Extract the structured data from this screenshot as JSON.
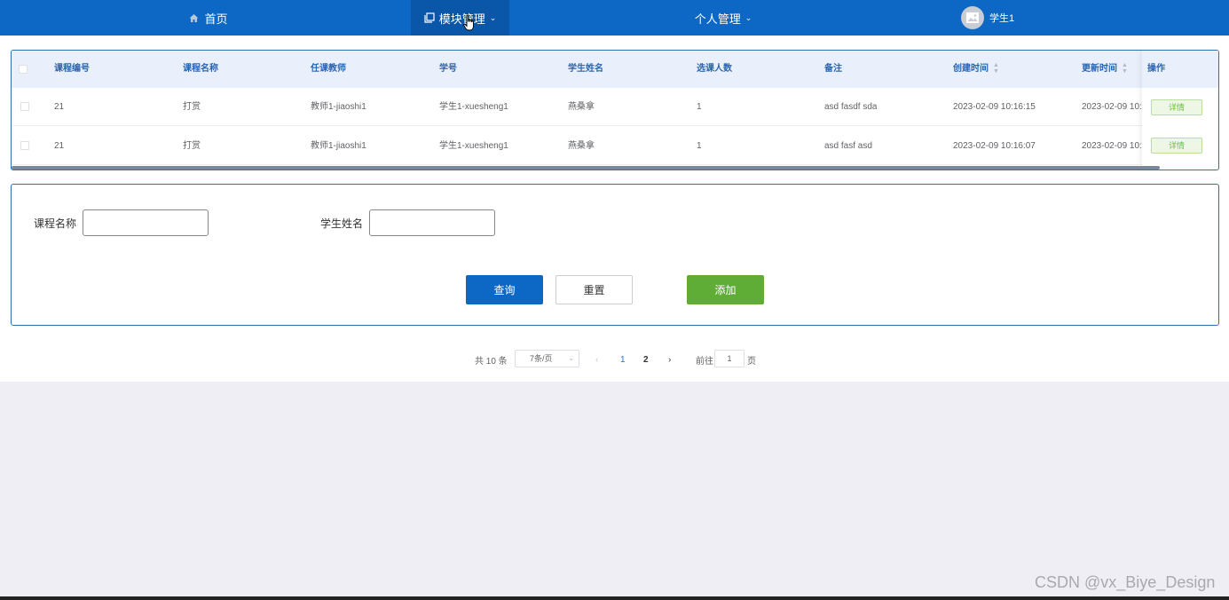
{
  "nav": {
    "home": "首页",
    "module": "模块管理",
    "personal": "个人管理",
    "user": "学生1"
  },
  "table": {
    "headers": [
      "课程编号",
      "课程名称",
      "任课教师",
      "学号",
      "学生姓名",
      "选课人数",
      "备注",
      "创建时间",
      "更新时间",
      "操作"
    ],
    "rows": [
      {
        "course_id": "21",
        "course_name": "打赏",
        "teacher": "教师1-jiaoshi1",
        "student_no": "学生1-xuesheng1",
        "student_name": "燕桑拿",
        "count": "1",
        "remark": "asd fasdf sda",
        "created": "2023-02-09 10:16:15",
        "updated": "2023-02-09 10:",
        "action": "详情"
      },
      {
        "course_id": "21",
        "course_name": "打赏",
        "teacher": "教师1-jiaoshi1",
        "student_no": "学生1-xuesheng1",
        "student_name": "燕桑拿",
        "count": "1",
        "remark": "asd fasf asd",
        "created": "2023-02-09 10:16:07",
        "updated": "2023-02-09 10:",
        "action": "详情"
      }
    ]
  },
  "search": {
    "course_name_label": "课程名称",
    "course_name_value": "",
    "student_name_label": "学生姓名",
    "student_name_value": "",
    "query_btn": "查询",
    "reset_btn": "重置",
    "add_btn": "添加"
  },
  "pager": {
    "total": "共 10 条",
    "page_size": "7条/页",
    "pages": [
      "1",
      "2"
    ],
    "current": "1",
    "goto_label": "前往",
    "goto_value": "1",
    "goto_unit": "页"
  },
  "watermark": "CSDN @vx_Biye_Design",
  "colors": {
    "nav": "#0d68c5",
    "primary": "#0d68c5",
    "success": "#5fad36"
  }
}
